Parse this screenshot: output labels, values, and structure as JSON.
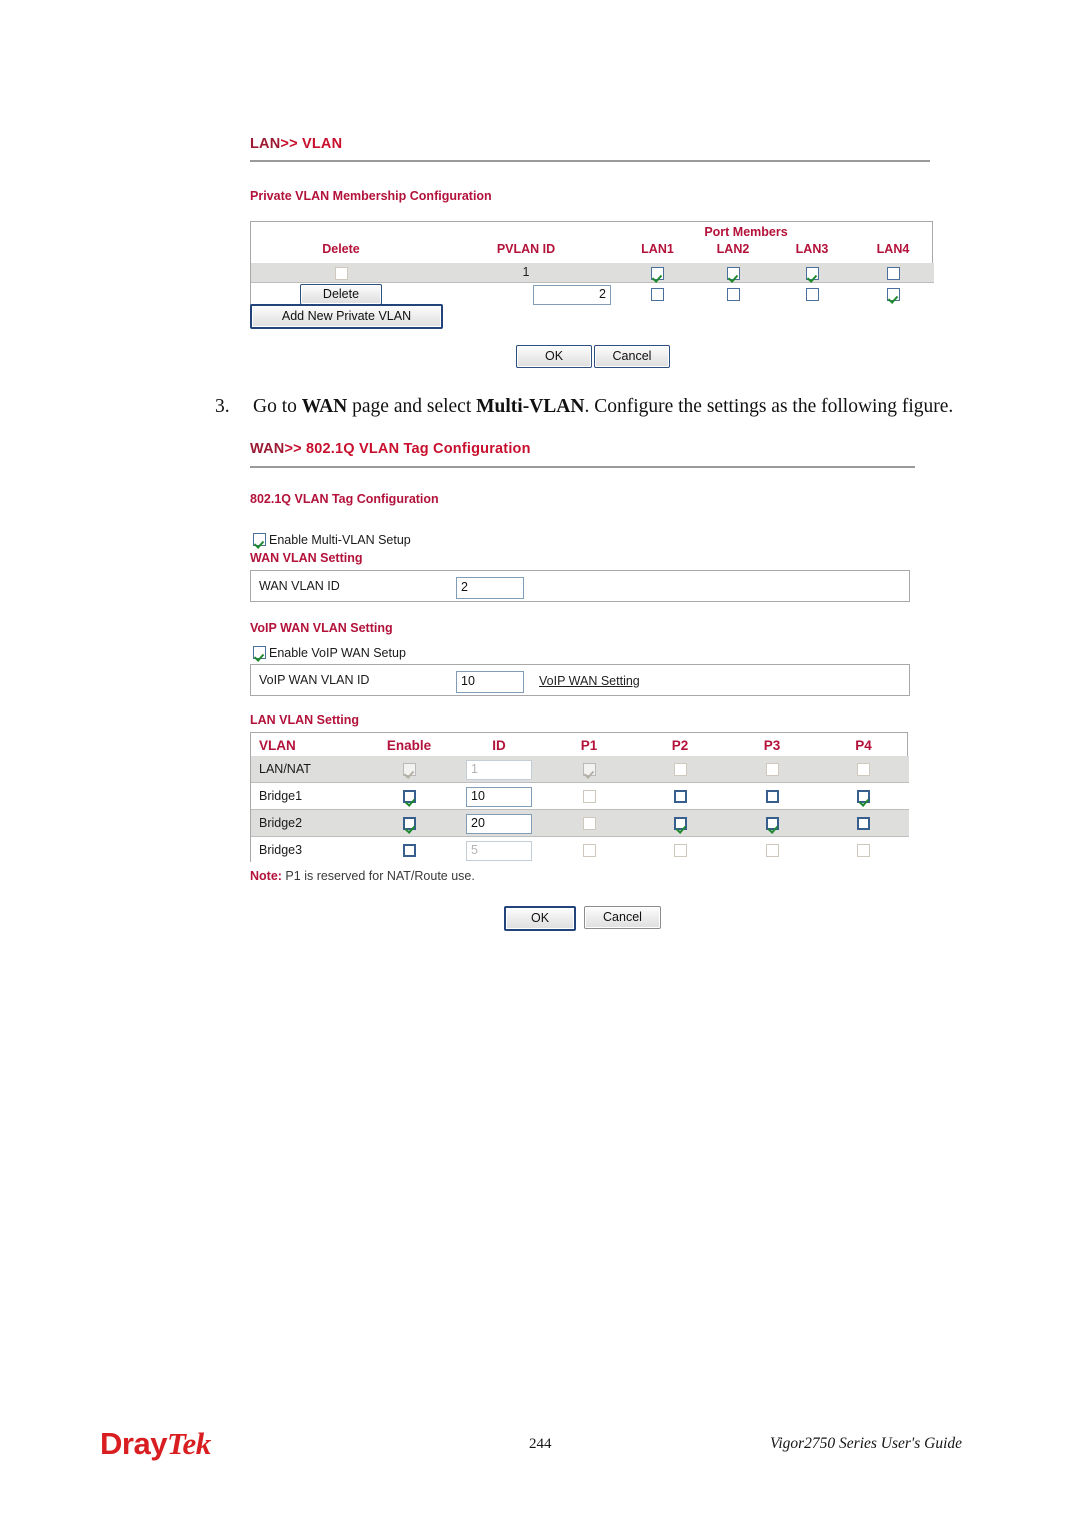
{
  "lan_vlan_page": {
    "title_main": "LAN",
    "title_sep": ">>",
    "title_sub": "VLAN",
    "section_title": "Private VLAN Membership Configuration",
    "port_members_label": "Port Members",
    "headers": [
      "Delete",
      "PVLAN ID",
      "LAN1",
      "LAN2",
      "LAN3",
      "LAN4"
    ],
    "rows": [
      {
        "delete_type": "checkbox",
        "delete_checked": false,
        "pvlan_id": "1",
        "pvlan_editable": false,
        "ports": [
          true,
          true,
          true,
          false
        ]
      },
      {
        "delete_type": "button",
        "delete_label": "Delete",
        "pvlan_id": "2",
        "pvlan_editable": true,
        "ports": [
          false,
          false,
          false,
          true
        ]
      }
    ],
    "add_button": "Add New Private VLAN",
    "ok_button": "OK",
    "cancel_button": "Cancel"
  },
  "instruction": {
    "number": "3.",
    "part1": "Go to ",
    "bold1": "WAN",
    "part2": " page and select ",
    "bold2": "Multi-VLAN",
    "part3": ". Configure the settings as the following figure."
  },
  "wan_vlan_page": {
    "title_main": "WAN",
    "title_sep": ">>",
    "title_sub": "802.1Q VLAN Tag Configuration",
    "section_title": "802.1Q VLAN Tag Configuration",
    "enable_multi_vlan_label": "Enable Multi-VLAN Setup",
    "enable_multi_vlan_checked": true,
    "wan_vlan_setting_title": "WAN VLAN Setting",
    "wan_vlan_id_label": "WAN VLAN ID",
    "wan_vlan_id_value": "2",
    "voip_section_title": "VoIP WAN VLAN Setting",
    "enable_voip_label": "Enable VoIP WAN Setup",
    "enable_voip_checked": true,
    "voip_vlan_id_label": "VoIP WAN VLAN ID",
    "voip_vlan_id_value": "10",
    "voip_link_label": "VoIP WAN Setting",
    "lan_vlan_setting_title": "LAN VLAN Setting",
    "lan_table_headers": [
      "VLAN",
      "Enable",
      "ID",
      "P1",
      "P2",
      "P3",
      "P4"
    ],
    "lan_rows": [
      {
        "name": "LAN/NAT",
        "enable_checked": true,
        "enable_disabled": true,
        "id_value": "1",
        "id_disabled": true,
        "ports": [
          true,
          false,
          false,
          false
        ],
        "ports_disabled": [
          true,
          true,
          true,
          true
        ],
        "shaded": true
      },
      {
        "name": "Bridge1",
        "enable_checked": true,
        "enable_disabled": false,
        "id_value": "10",
        "id_disabled": false,
        "ports": [
          false,
          false,
          false,
          true
        ],
        "ports_disabled": [
          true,
          false,
          false,
          false
        ],
        "shaded": false
      },
      {
        "name": "Bridge2",
        "enable_checked": true,
        "enable_disabled": false,
        "id_value": "20",
        "id_disabled": false,
        "ports": [
          false,
          true,
          true,
          false
        ],
        "ports_disabled": [
          true,
          false,
          false,
          false
        ],
        "shaded": true
      },
      {
        "name": "Bridge3",
        "enable_checked": false,
        "enable_disabled": false,
        "id_value": "5",
        "id_disabled": true,
        "ports": [
          false,
          false,
          false,
          false
        ],
        "ports_disabled": [
          true,
          true,
          true,
          true
        ],
        "shaded": false
      }
    ],
    "note_keyword": "Note:",
    "note_text": " P1 is reserved for NAT/Route use.",
    "ok_button": "OK",
    "cancel_button": "Cancel"
  },
  "footer": {
    "logo_first": "Dray",
    "logo_second": "Tek",
    "page_number": "244",
    "guide": "Vigor2750 Series User's Guide"
  },
  "colors": {
    "title_red": "#9c1b33",
    "accent_red": "#b3123a",
    "logo_red": "#d81e20",
    "check_green": "#1e8a2e",
    "row_grey": "#dededd"
  }
}
